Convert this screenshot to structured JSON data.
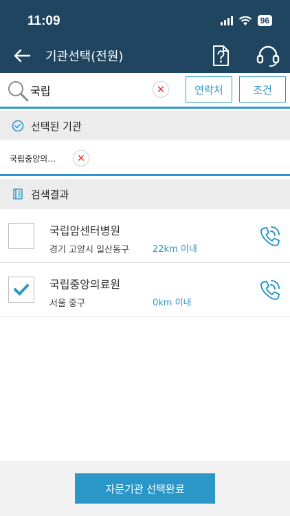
{
  "status_bar": {
    "time": "11:09",
    "battery": "96"
  },
  "app_bar": {
    "title": "기관선택(전원)",
    "help_icon": "question-document-icon",
    "support_icon": "headset-icon"
  },
  "search": {
    "query": "국립",
    "contact_label": "연락처",
    "condition_label": "조건"
  },
  "selected_section": {
    "label": "선택된 기관",
    "items": [
      {
        "name": "국립중앙의…"
      }
    ]
  },
  "results_section": {
    "label": "검색결과"
  },
  "results": [
    {
      "name": "국립암센터병원",
      "address": "경기 고양시 일산동구",
      "distance": "22km 이내",
      "checked": false
    },
    {
      "name": "국립중앙의료원",
      "address": "서울 중구",
      "distance": "0km 이내",
      "checked": true
    }
  ],
  "footer": {
    "submit_label": "자문기관 선택완료"
  },
  "colors": {
    "header": "#1f4560",
    "accent": "#2b97c9",
    "remove": "#e53935"
  }
}
